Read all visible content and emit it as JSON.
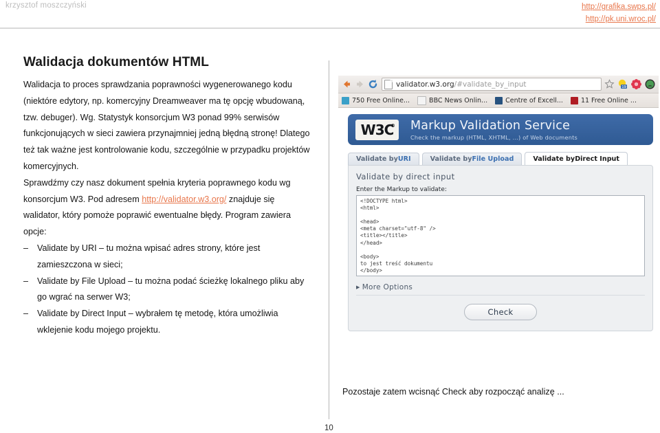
{
  "header": {
    "author": "krzysztof moszczyński",
    "links": [
      "http://grafika.swps.pl/",
      "http://pk.uni.wroc.pl/"
    ]
  },
  "slide": {
    "title": "Walidacja dokumentów HTML",
    "page_number": "10",
    "body_lines": [
      "Walidacja to proces sprawdzania poprawności wygenerowanego kodu",
      "(niektóre edytory, np. komercyjny Dreamweaver ma tę opcję wbudowaną,",
      "tzw. debuger). Wg. Statystyk konsorcjum W3 ponad 99% serwisów",
      "funkcjonujących w sieci zawiera przynajmniej jedną błędną stronę! Dlatego",
      "też tak ważne jest kontrolowanie kodu, szczególnie w przypadku projektów",
      "komercyjnych."
    ],
    "paragraph2": {
      "before_link": "Sprawdźmy czy nasz dokument spełnia kryteria poprawnego kodu wg",
      "line2_pre": "konsorcjum W3. Pod adresem ",
      "link": "http://validator.w3.org/",
      "line2_post": " znajduje się",
      "line3": "walidator, który pomoże poprawić ewentualne błędy. Program zawiera",
      "line4": "opcje:"
    },
    "bullets": [
      {
        "dash": "–",
        "line1": "Validate by URI – tu można wpisać adres strony, które jest",
        "line2": "zamieszczona w sieci;"
      },
      {
        "dash": "–",
        "line1": "Validate by File Upload – tu można podać ścieżkę lokalnego pliku aby",
        "line2": "go wgrać na serwer W3;"
      },
      {
        "dash": "–",
        "line1": "Validate by Direct Input – wybrałem tę metodę, która umożliwia",
        "line2": "wklejenie kodu mojego projektu."
      }
    ],
    "caption": "Pozostaje zatem wcisnąć Check aby rozpocząć analizę ..."
  },
  "browser": {
    "url_main": "validator.w3.org",
    "url_fragment": "/#validate_by_input",
    "bookmarks": [
      {
        "label": "750 Free Online...",
        "color": "#3aa0c8"
      },
      {
        "label": "BBC News Onlin...",
        "color": "#f2f2f2"
      },
      {
        "label": "Centre of Excell...",
        "color": "#27527f"
      },
      {
        "label": "11 Free Online ...",
        "color": "#b01d24"
      }
    ],
    "toolbar_icons": {
      "back": "back-arrow-icon",
      "forward": "forward-arrow-icon",
      "reload": "reload-icon",
      "page": "page-icon",
      "bookmark_star": "star-icon",
      "notification_badge": "19",
      "extension1": "flower-icon",
      "extension2": "green-circle-icon"
    }
  },
  "validator": {
    "logo_text": "W3C",
    "logo_sup": "®",
    "title": "Markup Validation Service",
    "subtitle": "Check the markup (HTML, XHTML, ...) of Web documents",
    "tabs": [
      {
        "prefix": "Validate by ",
        "highlight": "URI",
        "active": false
      },
      {
        "prefix": "Validate by ",
        "highlight": "File Upload",
        "active": false
      },
      {
        "prefix": "Validate by ",
        "highlight": "Direct Input",
        "active": true
      }
    ],
    "panel_title": "Validate by direct input",
    "field_label": "Enter the Markup to validate:",
    "code": "<!DOCTYPE html>\n<html>\n\n<head>\n<meta charset=\"utf-8\" />\n<title></title>\n</head>\n\n<body>\nto jest treść dokumentu\n</body>\n\n</html>",
    "more_options": "More Options",
    "check_button": "Check"
  }
}
